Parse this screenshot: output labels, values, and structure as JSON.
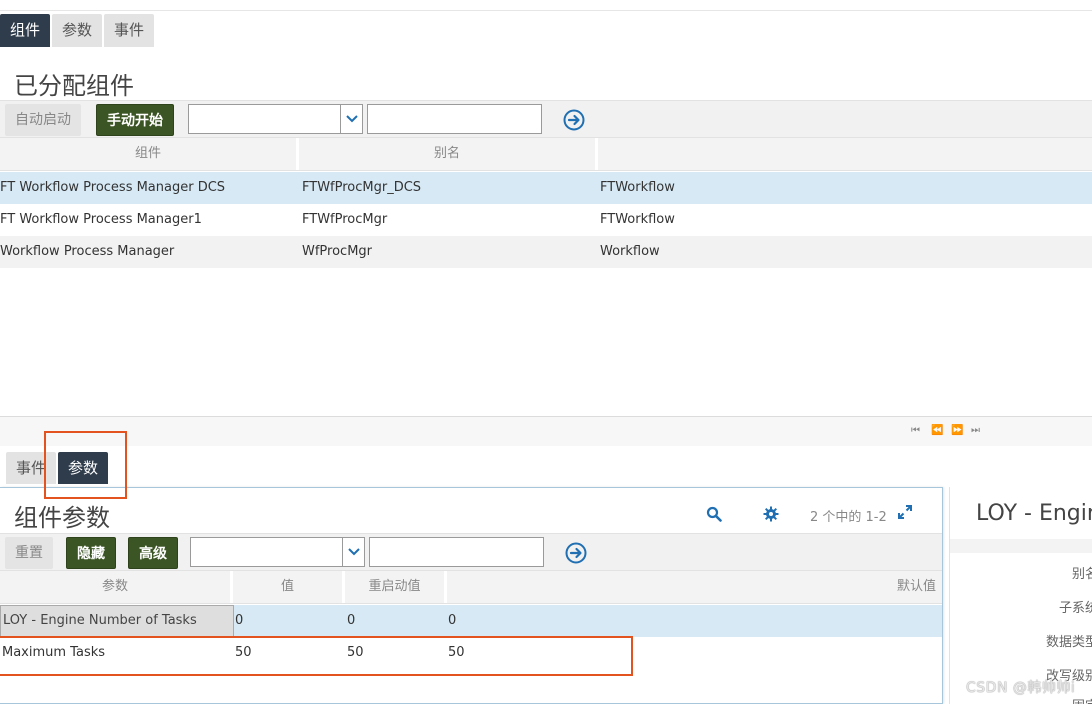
{
  "top_tabs": [
    {
      "label": "组件",
      "active": true
    },
    {
      "label": "参数",
      "active": false
    },
    {
      "label": "事件",
      "active": false
    }
  ],
  "assigned": {
    "title": "已分配组件",
    "toolbar": {
      "auto_start": "自动启动",
      "manual_start": "手动开始",
      "select_value": "",
      "input_value": ""
    },
    "columns": [
      "组件",
      "别名",
      ""
    ],
    "rows": [
      {
        "component": "FT Workflow Process Manager DCS",
        "alias": "FTWfProcMgr_DCS",
        "group": "FTWorkflow"
      },
      {
        "component": "FT Workflow Process Manager1",
        "alias": "FTWfProcMgr",
        "group": "FTWorkflow"
      },
      {
        "component": "Workflow Process Manager",
        "alias": "WfProcMgr",
        "group": "Workflow"
      }
    ]
  },
  "pager_icons": [
    "first-page-icon",
    "prev-page-icon",
    "next-page-icon",
    "last-page-icon"
  ],
  "bottom_tabs": [
    {
      "label": "事件",
      "active": false
    },
    {
      "label": "参数",
      "active": true
    }
  ],
  "params": {
    "title": "组件参数",
    "count": "2 个中的 1-2",
    "toolbar": {
      "reset": "重置",
      "hide": "隐藏",
      "advanced": "高级",
      "select_value": "",
      "input_value": ""
    },
    "columns": [
      "参数",
      "值",
      "重启动值",
      "默认值"
    ],
    "rows": [
      {
        "name": "LOY - Engine Number of Tasks",
        "value": "0",
        "restart_value": "0",
        "default_value": "0"
      },
      {
        "name": "Maximum Tasks",
        "value": "50",
        "restart_value": "50",
        "default_value": "50"
      }
    ]
  },
  "detail": {
    "title": "LOY - Engine",
    "labels": [
      "别名",
      "子系统",
      "数据类型",
      "改写级别",
      "固定"
    ]
  },
  "watermark": "CSDN @韩帅帅i",
  "colors": {
    "accent": "#1f6fb2",
    "active_tab": "#2f3c4b",
    "green_button": "#3b5524",
    "selection": "#d6e9f5",
    "highlight": "#e2531f"
  }
}
